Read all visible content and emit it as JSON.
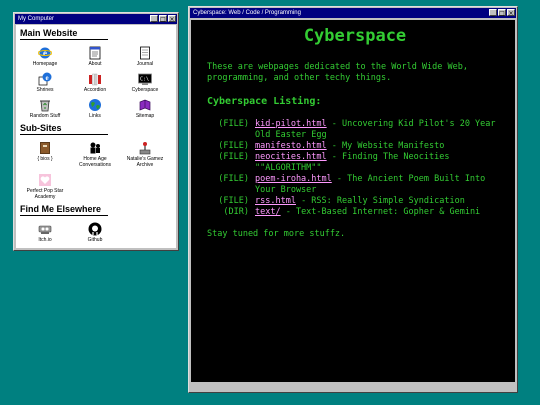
{
  "window1": {
    "title": "My Computer",
    "sections": [
      {
        "title": "Main Website",
        "items": [
          {
            "label": "Homepage",
            "icon": "ie-icon"
          },
          {
            "label": "About",
            "icon": "notepad-icon"
          },
          {
            "label": "Journal",
            "icon": "document-icon"
          },
          {
            "label": "Shrines",
            "icon": "shrine-icon"
          },
          {
            "label": "Accordion",
            "icon": "accordion-icon"
          },
          {
            "label": "Cyberspace",
            "icon": "terminal-icon"
          },
          {
            "label": "Random Stuff",
            "icon": "recycle-icon"
          },
          {
            "label": "Links",
            "icon": "globe-icon"
          },
          {
            "label": "Sitemap",
            "icon": "book-icon"
          }
        ]
      },
      {
        "title": "Sub-Sites",
        "items": [
          {
            "label": "{ bios }",
            "icon": "bios-icon"
          },
          {
            "label": "Home Age Conversations",
            "icon": "people-icon"
          },
          {
            "label": "Natalie's Gamez Archive",
            "icon": "joystick-icon"
          },
          {
            "label": "Perfect Pop Star Academy",
            "icon": "heart-icon"
          }
        ]
      },
      {
        "title": "Find Me Elsewhere",
        "items": [
          {
            "label": "Itch.io",
            "icon": "itch-icon"
          },
          {
            "label": "Github",
            "icon": "github-icon"
          }
        ]
      }
    ]
  },
  "window2": {
    "title": "Cyberspace: Web / Code / Programming",
    "heading": "Cyberspace",
    "intro": "These are webpages dedicated to the World Wide Web, programming, and other techy things.",
    "listing_title": "Cyberspace Listing:",
    "entries": [
      {
        "type": "(FILE)",
        "name": "kid-pilot.html",
        "desc": " - Uncovering Kid Pilot's 20 Year Old Easter Egg"
      },
      {
        "type": "(FILE)",
        "name": "manifesto.html",
        "desc": " - My Website Manifesto"
      },
      {
        "type": "(FILE)",
        "name": "neocities.html",
        "desc": " - Finding The Neocities \"\"ALGORITHM\"\""
      },
      {
        "type": "(FILE)",
        "name": "poem-iroha.html",
        "desc": " - The Ancient Poem Built Into Your Browser"
      },
      {
        "type": "(FILE)",
        "name": "rss.html",
        "desc": " - RSS: Really Simple Syndication"
      },
      {
        "type": "(DIR)",
        "name": "text/",
        "desc": " - Text-Based Internet: Gopher & Gemini"
      }
    ],
    "footer": "Stay tuned for more stuffz."
  },
  "controls": {
    "minimize": "_",
    "maximize": "□",
    "close": "×"
  },
  "colors": {
    "desktop": "#008080",
    "titlebar": "#000080",
    "terminal_text": "#33cc33",
    "link": "#ff99ff"
  }
}
